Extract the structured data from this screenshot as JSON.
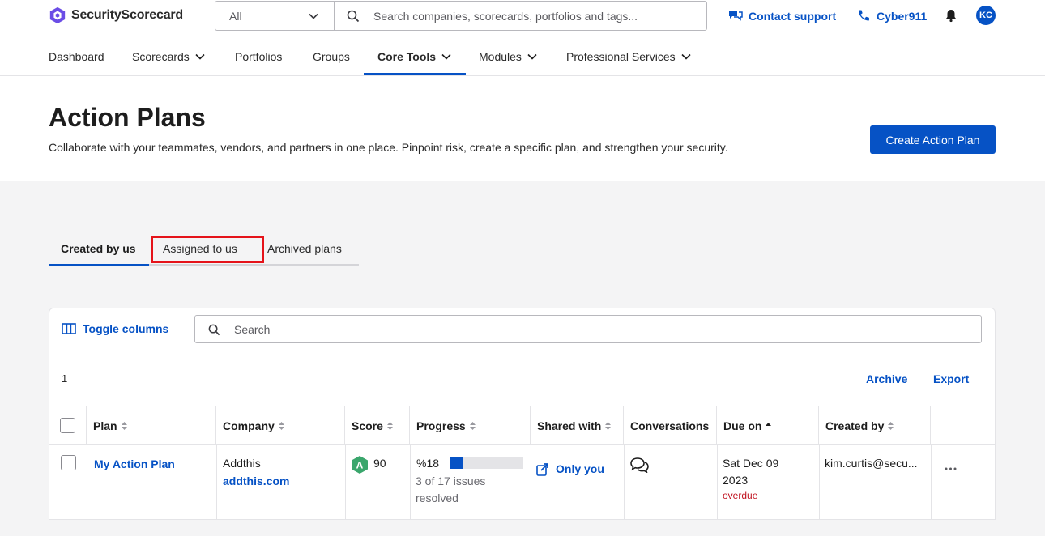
{
  "brand": {
    "name": "SecurityScorecard",
    "accent": "#0652c5",
    "logo_color": "#6b4de6"
  },
  "header": {
    "scope_value": "All",
    "search_placeholder": "Search companies, scorecards, portfolios and tags...",
    "contact_support": "Contact support",
    "cyber911": "Cyber911",
    "avatar_initials": "KC"
  },
  "nav": {
    "items": [
      {
        "label": "Dashboard"
      },
      {
        "label": "Scorecards"
      },
      {
        "label": "Portfolios"
      },
      {
        "label": "Groups"
      },
      {
        "label": "Core Tools"
      },
      {
        "label": "Modules"
      },
      {
        "label": "Professional Services"
      }
    ]
  },
  "page": {
    "title": "Action Plans",
    "subtitle": "Collaborate with your teammates, vendors, and partners in one place. Pinpoint risk, create a specific plan, and strengthen your security.",
    "create_button": "Create Action Plan"
  },
  "tabs": [
    {
      "label": "Created by us"
    },
    {
      "label": "Assigned to us"
    },
    {
      "label": "Archived plans"
    }
  ],
  "table": {
    "toggle_columns": "Toggle columns",
    "search_placeholder": "Search",
    "row_count": "1",
    "archive": "Archive",
    "export": "Export",
    "columns": [
      "Plan",
      "Company",
      "Score",
      "Progress",
      "Shared with",
      "Conversations",
      "Due on",
      "Created by"
    ],
    "rows": [
      {
        "plan": "My Action Plan",
        "company_name": "Addthis",
        "company_domain": "addthis.com",
        "score_grade": "A",
        "score_value": "90",
        "progress_label": "%18",
        "progress_fraction": 0.18,
        "progress_detail": "3 of 17 issues resolved",
        "shared_with": "Only you",
        "due_line1": "Sat Dec 09",
        "due_line2": "2023",
        "due_status": "overdue",
        "created_by": "kim.curtis@secu..."
      }
    ]
  }
}
